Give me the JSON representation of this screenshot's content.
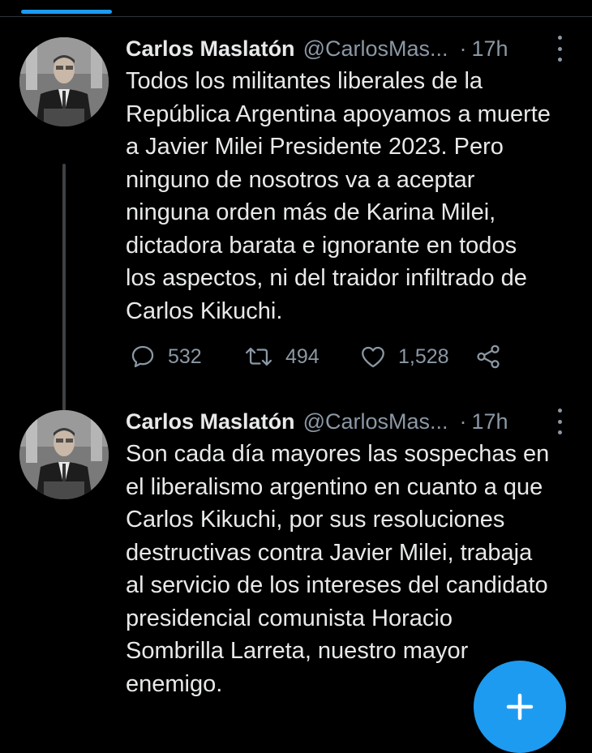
{
  "tweets": [
    {
      "author_name": "Carlos Maslatón",
      "handle": "@CarlosMas...",
      "separator": "·",
      "time": "17h",
      "lines": [
        "Todos los militantes liberales de la",
        "República Argentina apoyamos a muerte",
        "a Javier Milei Presidente 2023. Pero",
        "ninguno de nosotros va a aceptar",
        "ninguna orden más de Karina Milei,",
        "dictadora barata e ignorante en todos",
        "los aspectos, ni del traidor infiltrado de",
        "Carlos Kikuchi."
      ],
      "replies": "532",
      "retweets": "494",
      "likes": "1,528"
    },
    {
      "author_name": "Carlos Maslatón",
      "handle": "@CarlosMas...",
      "separator": "·",
      "time": "17h",
      "lines": [
        "Son cada día mayores las sospechas en",
        "el liberalismo argentino en cuanto a que",
        "Carlos Kikuchi, por sus resoluciones",
        "destructivas contra Javier Milei, trabaja",
        "al servicio de los intereses del candidato",
        "presidencial comunista Horacio",
        "Sombrilla Larreta, nuestro mayor",
        "enemigo."
      ]
    }
  ],
  "icons": {
    "reply": "reply-icon",
    "retweet": "retweet-icon",
    "like": "heart-icon",
    "share": "share-icon",
    "more": "more-icon",
    "compose": "plus-icon"
  },
  "colors": {
    "background": "#000000",
    "text": "#e7e9ea",
    "secondary": "#8b98a5",
    "accent": "#1d9bf0",
    "thread_line": "#3e4144"
  }
}
